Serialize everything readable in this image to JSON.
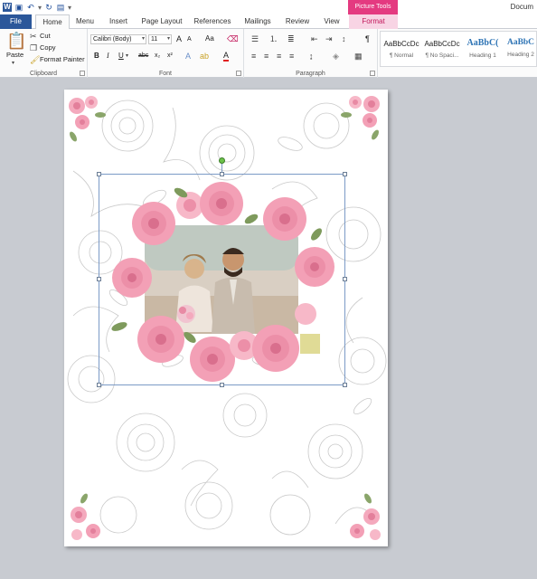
{
  "titlebar": {
    "app_icon": "word-icon",
    "document_title": "Docum",
    "contextual_tab_group": "Picture Tools"
  },
  "tabs": [
    {
      "label": "File",
      "icon": ""
    },
    {
      "label": "Home"
    },
    {
      "label": "Menu"
    },
    {
      "label": "Insert"
    },
    {
      "label": "Page Layout"
    },
    {
      "label": "References"
    },
    {
      "label": "Mailings"
    },
    {
      "label": "Review"
    },
    {
      "label": "View"
    },
    {
      "label": "Format"
    }
  ],
  "ribbon": {
    "clipboard": {
      "label": "Clipboard",
      "paste": "Paste",
      "cut": "Cut",
      "copy": "Copy",
      "format_painter": "Format Painter"
    },
    "font": {
      "label": "Font",
      "font_name": "Calibri (Body)",
      "font_size": "11",
      "bold": "B",
      "italic": "I",
      "underline": "U",
      "strike": "abc",
      "subscript": "x₂",
      "superscript": "x²",
      "grow": "A",
      "shrink": "A",
      "change_case": "Aa",
      "font_color": "A"
    },
    "paragraph": {
      "label": "Paragraph",
      "show_marks": "¶"
    },
    "styles": [
      {
        "sample": "AaBbCcDc",
        "name": "¶ Normal"
      },
      {
        "sample": "AaBbCcDc",
        "name": "¶ No Spaci..."
      },
      {
        "sample": "AaBbC(",
        "name": "Heading 1"
      },
      {
        "sample": "AaBbC",
        "name": "Heading 2"
      }
    ]
  },
  "colors": {
    "file_tab": "#2b579a",
    "picture_tools": "#e43a80",
    "format_tab_bg": "#f8d4e4",
    "selection": "#7b9ac6",
    "rose": "#e88aa4"
  }
}
